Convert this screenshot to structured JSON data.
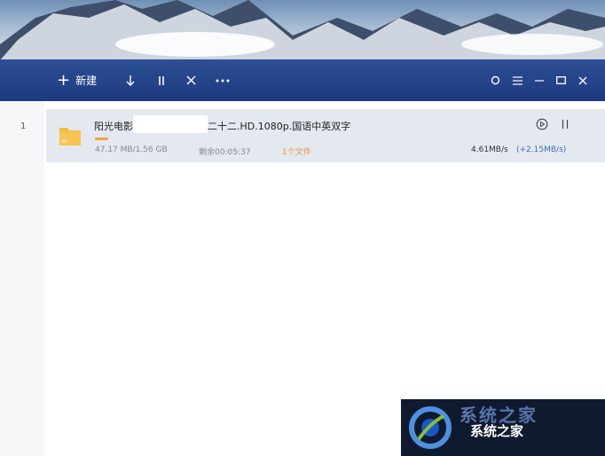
{
  "toolbar": {
    "new_label": "新建",
    "buttons": [
      "download-icon",
      "pause-icon",
      "close-icon",
      "more-icon"
    ],
    "window_controls": [
      "settings-icon",
      "menu-icon",
      "minimize-icon",
      "maximize-icon",
      "close-icon"
    ]
  },
  "tasks": [
    {
      "index": "1",
      "name_prefix": "阳光电影",
      "name_suffix": "二十二.HD.1080p.国语中英双字",
      "size": "47.17 MB/1.56 GB",
      "remaining": "剩余00:05:37",
      "files": "1个文件",
      "speed": "4.61MB/s",
      "boost_speed": "(+2.15MB/s)",
      "file_badge": "BT",
      "progress": 0.03
    }
  ],
  "watermark": {
    "text": "系统之家",
    "faded_text": "系统之家"
  },
  "colors": {
    "toolbar": "#1e3a80",
    "accent": "#f0a040",
    "boost": "#3a6fb8"
  }
}
